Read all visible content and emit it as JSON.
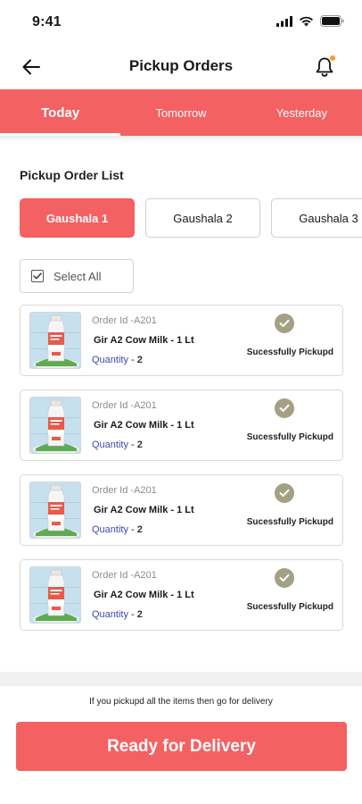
{
  "status_bar": {
    "time": "9:41"
  },
  "header": {
    "title": "Pickup Orders",
    "back_icon": "arrow-left-icon",
    "bell_icon": "bell-icon",
    "notification_dot_color": "#f0a033"
  },
  "tabs": [
    {
      "label": "Today",
      "active": true
    },
    {
      "label": "Tomorrow",
      "active": false
    },
    {
      "label": "Yesterday",
      "active": false
    }
  ],
  "section": {
    "title": "Pickup Order List"
  },
  "gaushalas": [
    {
      "label": "Gaushala 1",
      "active": true
    },
    {
      "label": "Gaushala 2",
      "active": false
    },
    {
      "label": "Gaushala 3",
      "active": false
    }
  ],
  "select_all": {
    "label": "Select All",
    "checked": true
  },
  "orders": [
    {
      "order_id": "Order Id -A201",
      "product": "Gir A2 Cow Milk  - 1 Lt",
      "quantity_label": "Quantity",
      "quantity_value": "2",
      "status": "Sucessfully Pickupd"
    },
    {
      "order_id": "Order Id -A201",
      "product": "Gir A2 Cow Milk  - 1 Lt",
      "quantity_label": "Quantity",
      "quantity_value": "2",
      "status": "Sucessfully Pickupd"
    },
    {
      "order_id": "Order Id -A201",
      "product": "Gir A2 Cow Milk  - 1 Lt",
      "quantity_label": "Quantity",
      "quantity_value": "2",
      "status": "Sucessfully Pickupd"
    },
    {
      "order_id": "Order Id -A201",
      "product": "Gir A2 Cow Milk  - 1 Lt",
      "quantity_label": "Quantity",
      "quantity_value": "2",
      "status": "Sucessfully Pickupd"
    }
  ],
  "footer": {
    "note": "If you pickupd all the items then go for delivery",
    "button_label": "Ready for Delivery"
  },
  "colors": {
    "accent": "#f46163",
    "check": "#a3a083",
    "quantity": "#3b4aa8"
  }
}
